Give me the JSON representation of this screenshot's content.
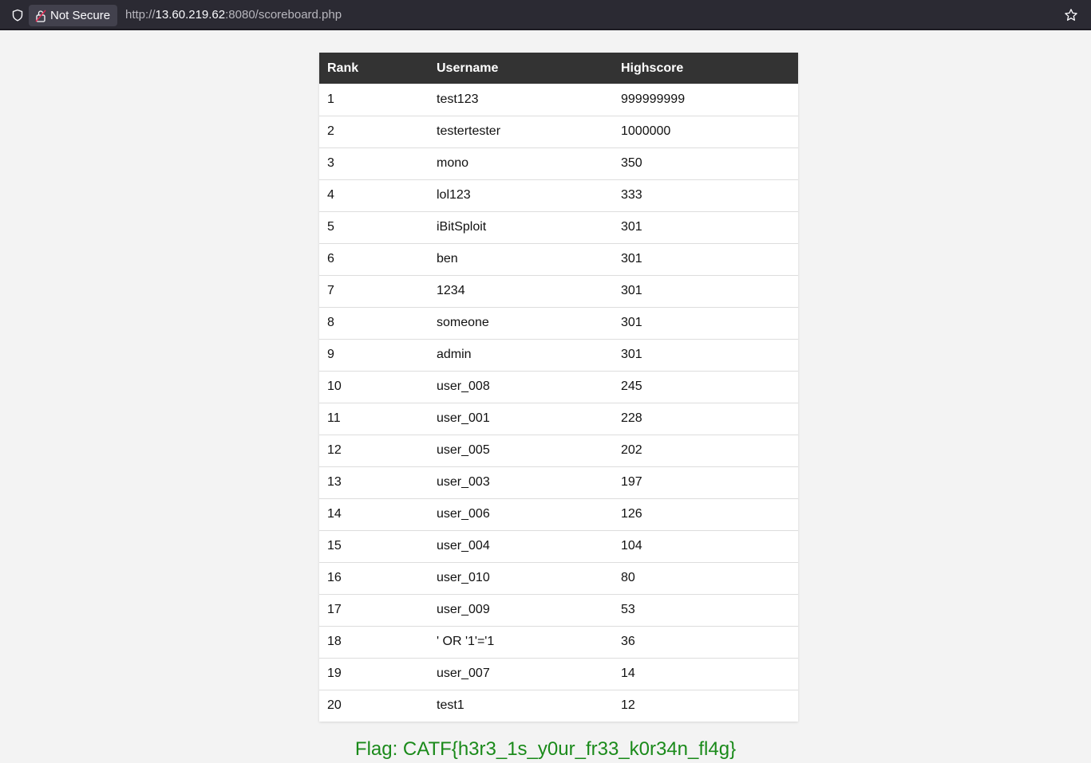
{
  "browser": {
    "security_label": "Not Secure",
    "url_prefix": "http://",
    "url_host": "13.60.219.62",
    "url_rest": ":8080/scoreboard.php"
  },
  "table": {
    "headers": [
      "Rank",
      "Username",
      "Highscore"
    ],
    "rows": [
      [
        "1",
        "test123",
        "999999999"
      ],
      [
        "2",
        "testertester",
        "1000000"
      ],
      [
        "3",
        "mono",
        "350"
      ],
      [
        "4",
        "lol123",
        "333"
      ],
      [
        "5",
        "iBitSploit",
        "301"
      ],
      [
        "6",
        "ben",
        "301"
      ],
      [
        "7",
        "1234",
        "301"
      ],
      [
        "8",
        "someone",
        "301"
      ],
      [
        "9",
        "admin",
        "301"
      ],
      [
        "10",
        "user_008",
        "245"
      ],
      [
        "11",
        "user_001",
        "228"
      ],
      [
        "12",
        "user_005",
        "202"
      ],
      [
        "13",
        "user_003",
        "197"
      ],
      [
        "14",
        "user_006",
        "126"
      ],
      [
        "15",
        "user_004",
        "104"
      ],
      [
        "16",
        "user_010",
        "80"
      ],
      [
        "17",
        "user_009",
        "53"
      ],
      [
        "18",
        "' OR '1'='1",
        "36"
      ],
      [
        "19",
        "user_007",
        "14"
      ],
      [
        "20",
        "test1",
        "12"
      ]
    ]
  },
  "flag_text": "Flag: CATF{h3r3_1s_y0ur_fr33_k0r34n_fl4g}",
  "colors": {
    "header_bg": "#333333",
    "flag": "#1a8a1a",
    "page_bg": "#f3f3f3"
  },
  "icons": {
    "shield": "shield-icon",
    "lock": "insecure-lock-icon",
    "bookmark": "bookmark-star-icon"
  }
}
